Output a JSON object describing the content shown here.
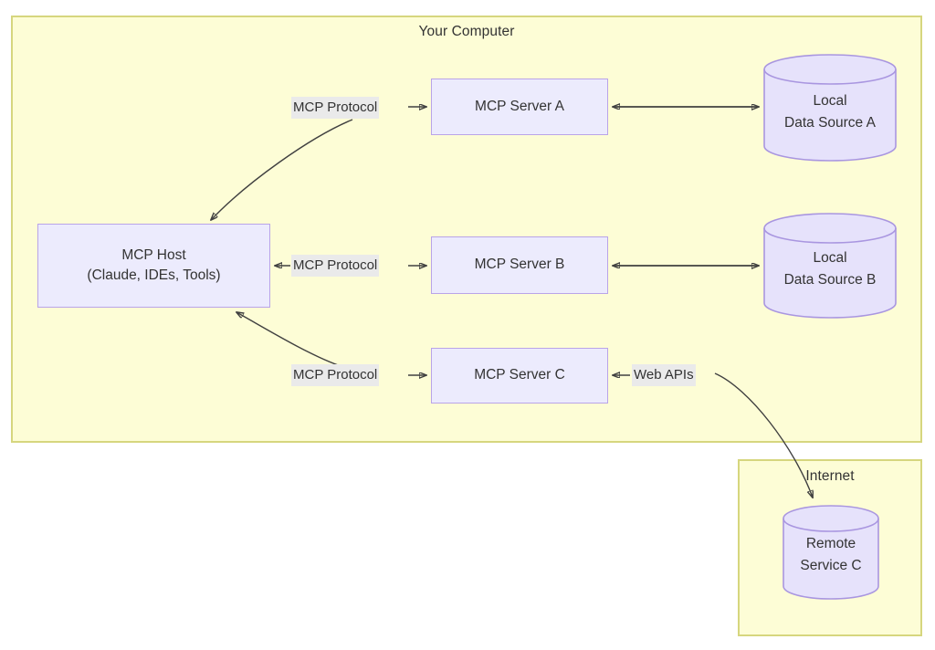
{
  "diagram": {
    "title_visible": false,
    "groups": [
      {
        "id": "your-computer",
        "label": "Your Computer"
      },
      {
        "id": "internet",
        "label": "Internet"
      }
    ],
    "nodes": {
      "mcp_host": {
        "line1": "MCP Host",
        "line2": "(Claude, IDEs, Tools)"
      },
      "server_a": {
        "label": "MCP Server A"
      },
      "server_b": {
        "label": "MCP Server B"
      },
      "server_c": {
        "label": "MCP Server C"
      }
    },
    "datastores": {
      "local_a": {
        "line1": "Local",
        "line2": "Data Source A"
      },
      "local_b": {
        "line1": "Local",
        "line2": "Data Source B"
      },
      "remote_c": {
        "line1": "Remote",
        "line2": "Service C"
      }
    },
    "edge_labels": {
      "protocol_a": "MCP Protocol",
      "protocol_b": "MCP Protocol",
      "protocol_c": "MCP Protocol",
      "web_apis": "Web APIs"
    },
    "colors": {
      "group_fill": "#fdfdd6",
      "group_stroke": "#d6d67e",
      "node_fill": "#ecebfd",
      "node_stroke": "#b9a4e8",
      "cylinder_fill": "#e6e2fb",
      "cylinder_stroke": "#a996e0",
      "edge_stroke": "#404040",
      "edge_label_bg": "#eaeaea",
      "text": "#333333",
      "page_bg": "#ffffff"
    }
  }
}
